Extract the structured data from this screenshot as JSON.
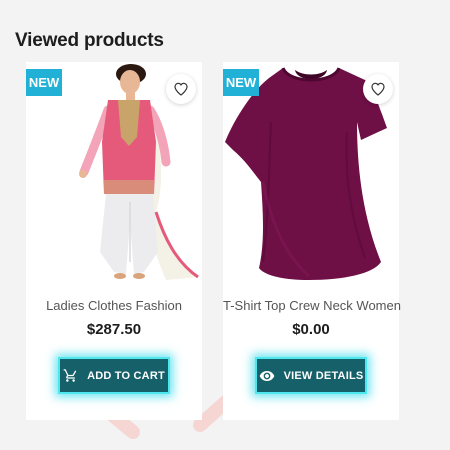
{
  "section": {
    "title": "Viewed products"
  },
  "products": [
    {
      "badge": "NEW",
      "name": "Ladies Clothes Fashion",
      "price": "$287.50",
      "action_label": "ADD TO CART",
      "action_icon": "cart-icon",
      "wishlist_icon": "heart-icon"
    },
    {
      "badge": "NEW",
      "name": "T-Shirt Top Crew Neck Women",
      "price": "$0.00",
      "action_label": "VIEW DETAILS",
      "action_icon": "eye-icon",
      "wishlist_icon": "heart-icon"
    }
  ],
  "colors": {
    "badge": "#22b1d6",
    "button": "#16606a",
    "button_glow": "#4fe7ef",
    "tshirt": "#6e0f45",
    "kurta": "#e55a7a"
  }
}
